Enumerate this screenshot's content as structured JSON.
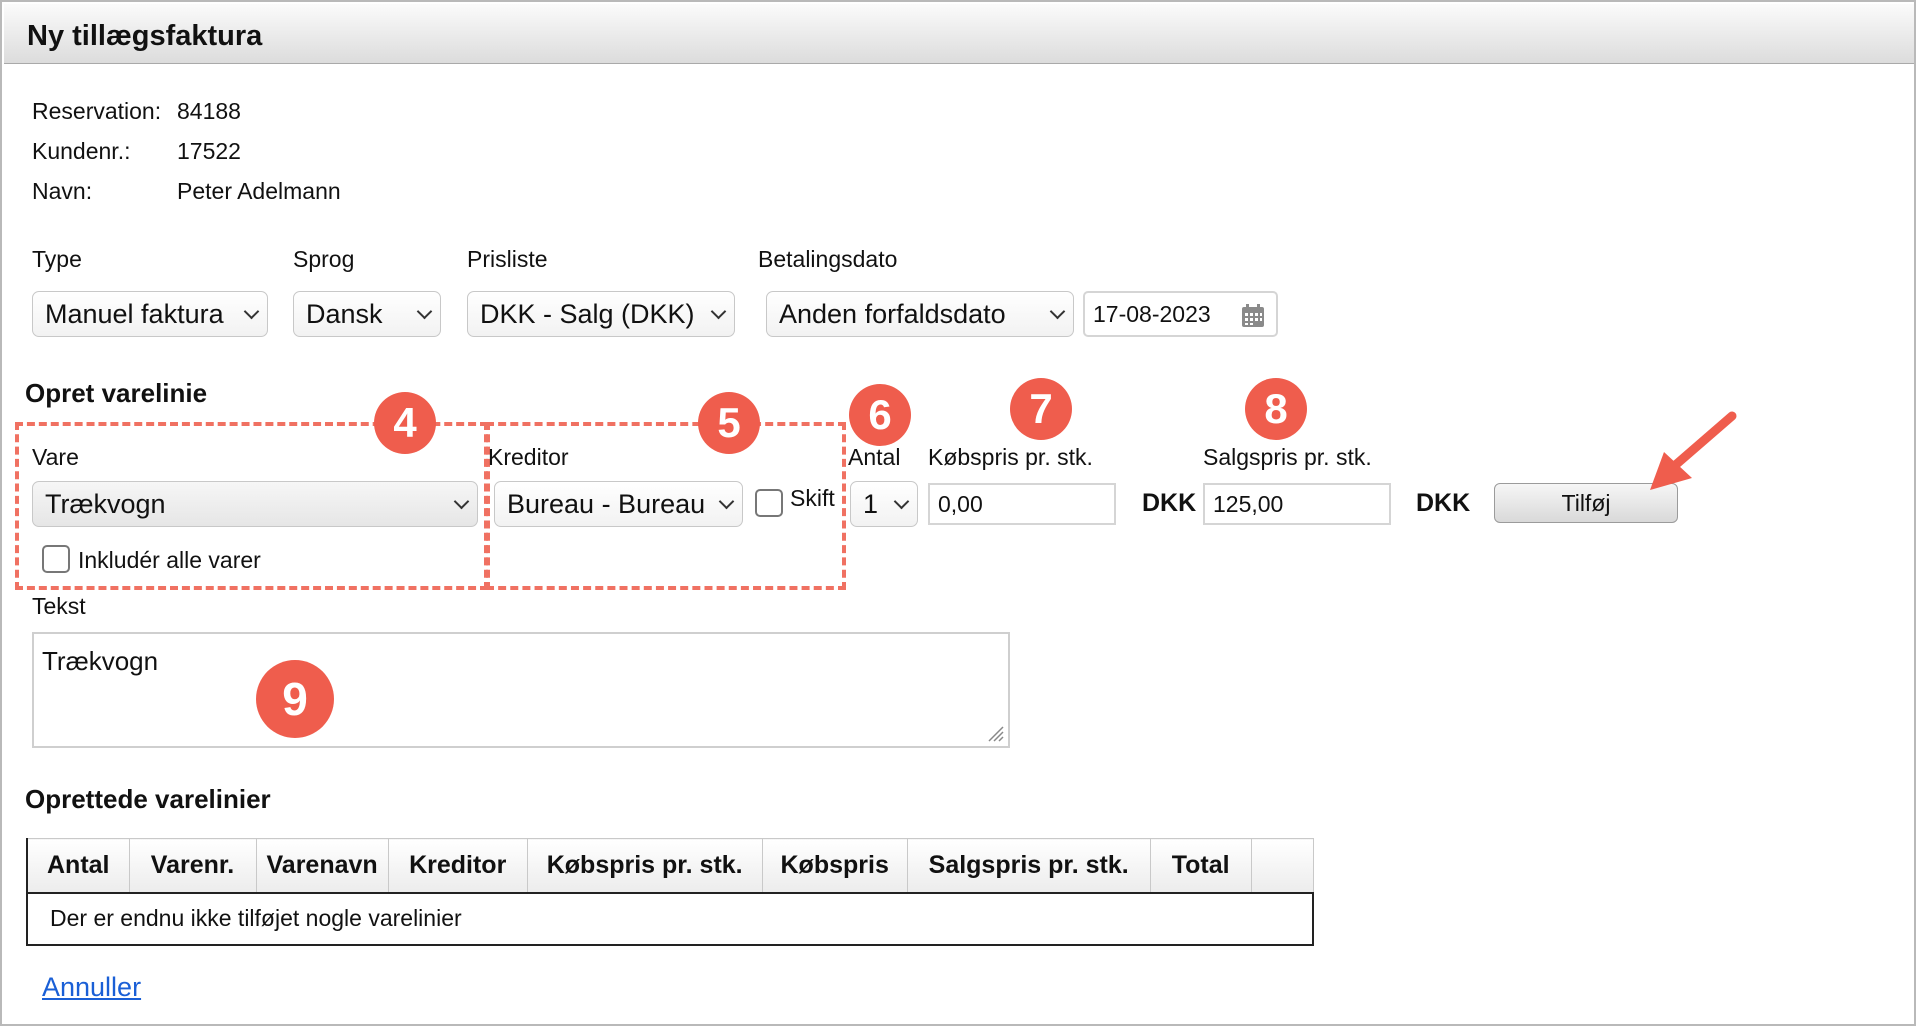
{
  "window": {
    "title": "Ny tillægsfaktura"
  },
  "info": {
    "reservation_label": "Reservation:",
    "reservation_value": "84188",
    "kundenr_label": "Kundenr.:",
    "kundenr_value": "17522",
    "navn_label": "Navn:",
    "navn_value": "Peter Adelmann"
  },
  "filters": {
    "type_label": "Type",
    "type_value": "Manuel faktura",
    "sprog_label": "Sprog",
    "sprog_value": "Dansk",
    "prisliste_label": "Prisliste",
    "prisliste_value": "DKK - Salg (DKK)",
    "betalingsdato_label": "Betalingsdato",
    "betalingsdato_value": "Anden forfaldsdato",
    "date_value": "17-08-2023"
  },
  "opret": {
    "heading": "Opret varelinie",
    "vare_label": "Vare",
    "vare_value": "Trækvogn",
    "include_all_label": "Inkludér alle varer",
    "kreditor_label": "Kreditor",
    "kreditor_value": "Bureau - Bureau",
    "skift_label": "Skift",
    "antal_label": "Antal",
    "antal_value": "1",
    "kobspris_label": "Købspris pr. stk.",
    "kobspris_value": "0,00",
    "salgspris_label": "Salgspris pr. stk.",
    "salgspris_value": "125,00",
    "currency": "DKK",
    "add_button": "Tilføj",
    "tekst_label": "Tekst",
    "tekst_value": "Trækvogn"
  },
  "badges": [
    "4",
    "5",
    "6",
    "7",
    "8",
    "9"
  ],
  "table": {
    "heading": "Oprettede varelinier",
    "columns": [
      "Antal",
      "Varenr.",
      "Varenavn",
      "Kreditor",
      "Købspris pr. stk.",
      "Købspris",
      "Salgspris pr. stk.",
      "Total",
      ""
    ],
    "empty_text": "Der er endnu ikke tilføjet nogle varelinier"
  },
  "footer": {
    "cancel_link": "Annuller"
  },
  "colors": {
    "annotation": "#ef5d4d",
    "link": "#1a5fd6"
  },
  "icons": {
    "calendar": "calendar-icon",
    "chevron": "chevron-down-icon",
    "arrow": "annotation-arrow-icon"
  }
}
